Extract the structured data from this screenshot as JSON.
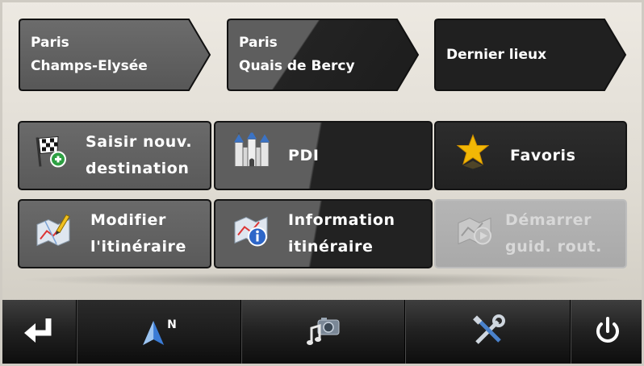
{
  "recent_destinations": [
    {
      "line1": "Paris",
      "line2": "Champs-Elysée"
    },
    {
      "line1": "Paris",
      "line2": "Quais de Bercy"
    },
    {
      "line1": "Dernier lieux"
    }
  ],
  "menu": {
    "new_destination": {
      "line1": "Saisir nouv.",
      "line2": "destination",
      "icon": "checkered-flag-add-icon"
    },
    "poi": {
      "label": "PDI",
      "icon": "castle-icon"
    },
    "favorites": {
      "label": "Favoris",
      "icon": "star-icon"
    },
    "edit_route": {
      "line1": "Modifier",
      "line2": "l'itinéraire",
      "icon": "map-pencil-icon"
    },
    "route_info": {
      "line1": "Information",
      "line2": "itinéraire",
      "icon": "map-info-icon"
    },
    "start_guidance": {
      "line1": "Démarrer",
      "line2": "guid. rout.",
      "icon": "map-play-icon",
      "enabled": false
    }
  },
  "toolbar": {
    "back": {
      "icon": "back-arrow-icon"
    },
    "map": {
      "icon": "compass-north-icon",
      "compass_label": "N",
      "active": true
    },
    "media": {
      "icon": "media-icon"
    },
    "settings": {
      "icon": "tools-icon"
    },
    "power": {
      "icon": "power-icon"
    }
  },
  "colors": {
    "tile_dark": "#222222",
    "tile_grey": "#5e5e5e",
    "tile_disabled": "#b0b0b0",
    "background": "#e6e2da",
    "star": "#f2b705",
    "arrow_blue": "#3a7bd5"
  }
}
